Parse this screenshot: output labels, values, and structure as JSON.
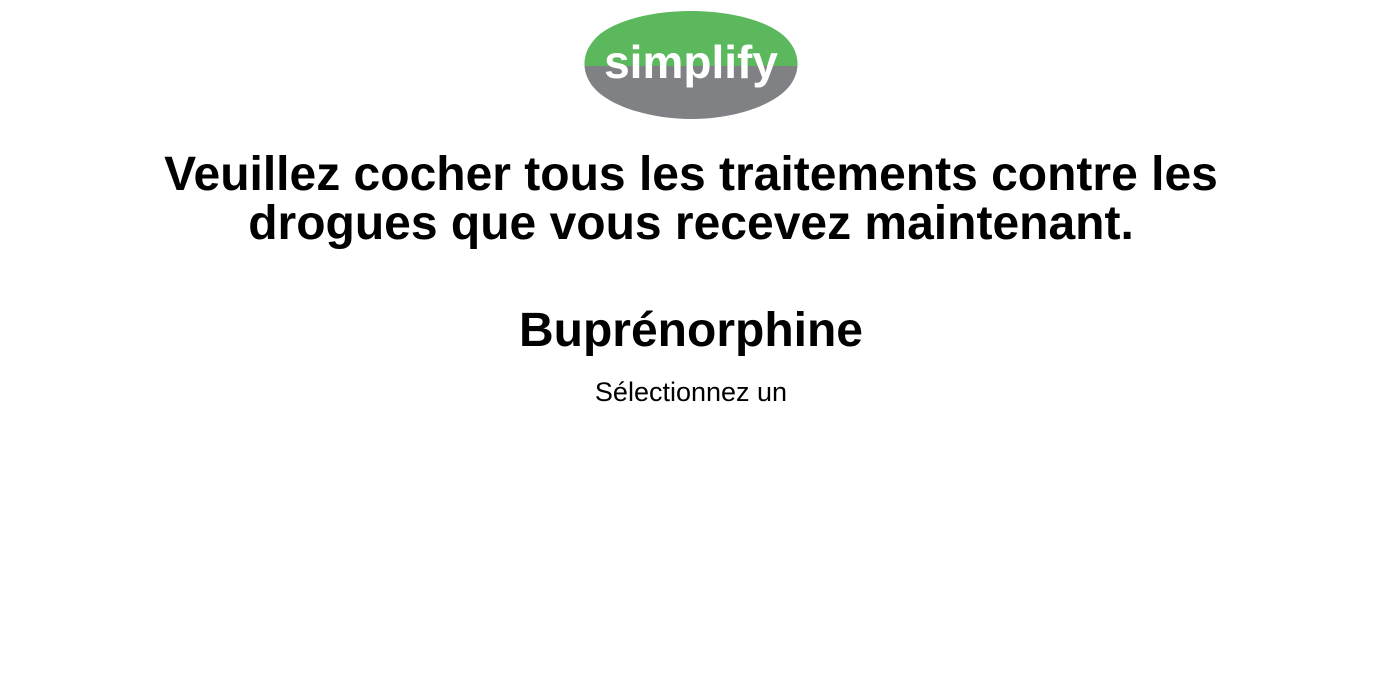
{
  "brand": {
    "logo_text": "simplify",
    "colors": {
      "top": "#5cb85c",
      "bottom": "#808184",
      "text": "#ffffff"
    }
  },
  "question": {
    "line1": "Veuillez cocher tous les traitements contre les",
    "line2": "drogues que vous recevez maintenant."
  },
  "drug": {
    "name": "Buprénorphine",
    "prompt": "Sélectionnez un"
  }
}
